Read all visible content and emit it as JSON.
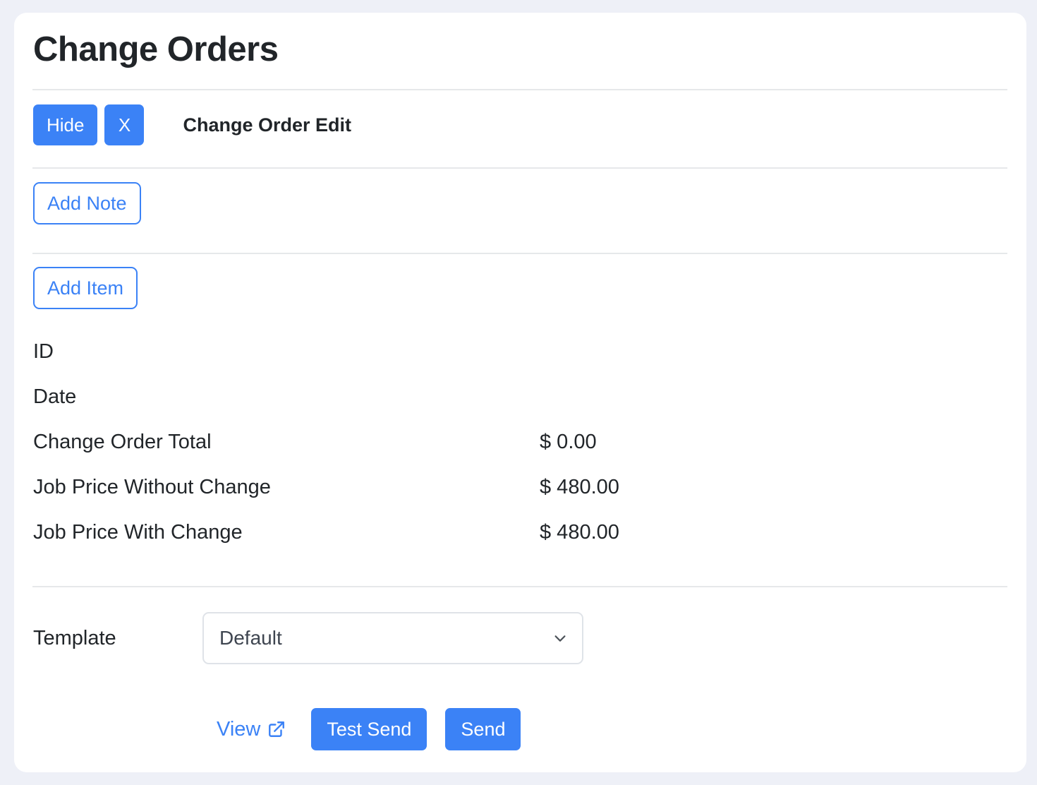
{
  "page": {
    "title": "Change Orders"
  },
  "panel": {
    "hide_label": "Hide",
    "close_label": "X",
    "section_title": "Change Order Edit"
  },
  "actions": {
    "add_note_label": "Add Note",
    "add_item_label": "Add Item"
  },
  "info_rows": [
    {
      "label": "ID",
      "value": ""
    },
    {
      "label": "Date",
      "value": ""
    },
    {
      "label": "Change Order Total",
      "value": "$ 0.00"
    },
    {
      "label": "Job Price Without Change",
      "value": "$ 480.00"
    },
    {
      "label": "Job Price With Change",
      "value": "$ 480.00"
    }
  ],
  "template": {
    "label": "Template",
    "selected": "Default",
    "chevron_icon": "chevron-down-icon"
  },
  "footer": {
    "view_label": "View",
    "view_icon": "external-link-icon",
    "test_send_label": "Test Send",
    "send_label": "Send"
  },
  "colors": {
    "primary": "#3b82f6",
    "page_background": "#eef0f7",
    "card_background": "#ffffff",
    "text": "#212529",
    "divider": "#e6e8ea",
    "border": "#dfe3e8"
  }
}
